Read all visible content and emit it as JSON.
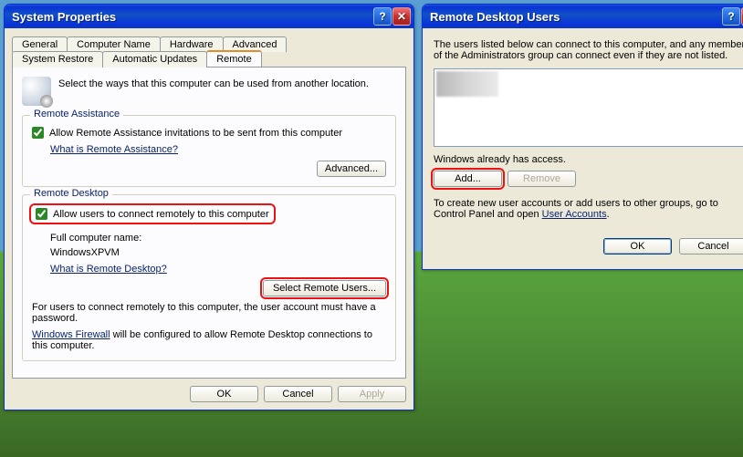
{
  "sysprop": {
    "title": "System Properties",
    "tabs_row1": [
      "General",
      "Computer Name",
      "Hardware",
      "Advanced"
    ],
    "tabs_row2": [
      "System Restore",
      "Automatic Updates",
      "Remote"
    ],
    "active_tab": "Remote",
    "intro": "Select the ways that this computer can be used from another location.",
    "ra": {
      "legend": "Remote Assistance",
      "check_label": "Allow Remote Assistance invitations to be sent from this computer",
      "link": "What is Remote Assistance?",
      "advanced_btn": "Advanced..."
    },
    "rd": {
      "legend": "Remote Desktop",
      "check_label": "Allow users to connect remotely to this computer",
      "fullname_label": "Full computer name:",
      "fullname_value": "WindowsXPVM",
      "link": "What is Remote Desktop?",
      "select_btn": "Select Remote Users...",
      "note": "For users to connect remotely to this computer, the user account must have a password.",
      "fw_link": "Windows Firewall",
      "fw_tail": " will be configured to allow Remote Desktop connections to this computer."
    },
    "ok": "OK",
    "cancel": "Cancel",
    "apply": "Apply"
  },
  "rdu": {
    "title": "Remote Desktop Users",
    "intro": "The users listed below can connect to this computer, and any members of the Administrators group can connect even if they are not listed.",
    "access": "Windows already has access.",
    "add": "Add...",
    "remove": "Remove",
    "hint_pre": "To create new user accounts or add users to other groups, go to Control Panel and open ",
    "hint_link": "User Accounts",
    "hint_post": ".",
    "ok": "OK",
    "cancel": "Cancel"
  }
}
